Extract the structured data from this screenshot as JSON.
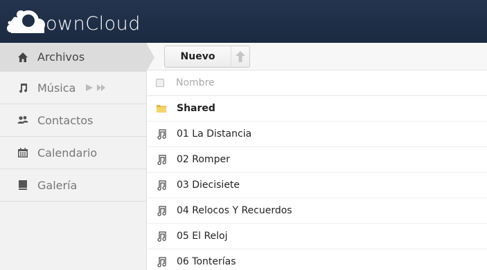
{
  "header": {
    "logo_text": "ownCloud"
  },
  "sidebar": {
    "items": [
      {
        "label": "Archivos",
        "icon": "home-icon",
        "active": true
      },
      {
        "label": "Música",
        "icon": "music-icon",
        "active": false
      },
      {
        "label": "Contactos",
        "icon": "contacts-icon",
        "active": false
      },
      {
        "label": "Calendario",
        "icon": "calendar-icon",
        "active": false
      },
      {
        "label": "Galería",
        "icon": "gallery-icon",
        "active": false
      }
    ]
  },
  "controls": {
    "new_label": "Nuevo",
    "upload_icon": "upload-arrow-icon"
  },
  "filelist": {
    "column_name": "Nombre",
    "rows": [
      {
        "name": "Shared",
        "type": "folder"
      },
      {
        "name": "01 La Distancia",
        "type": "audio"
      },
      {
        "name": "02 Romper",
        "type": "audio"
      },
      {
        "name": "03 Diecisiete",
        "type": "audio"
      },
      {
        "name": "04 Relocos Y Recuerdos",
        "type": "audio"
      },
      {
        "name": "05 El Reloj",
        "type": "audio"
      },
      {
        "name": "06 Tonterías",
        "type": "audio"
      }
    ]
  },
  "colors": {
    "header_bg": "#1d2d44",
    "sidebar_bg": "#f2f2f2",
    "active_item_bg": "#dcdcdc",
    "folder": "#f0c040"
  }
}
